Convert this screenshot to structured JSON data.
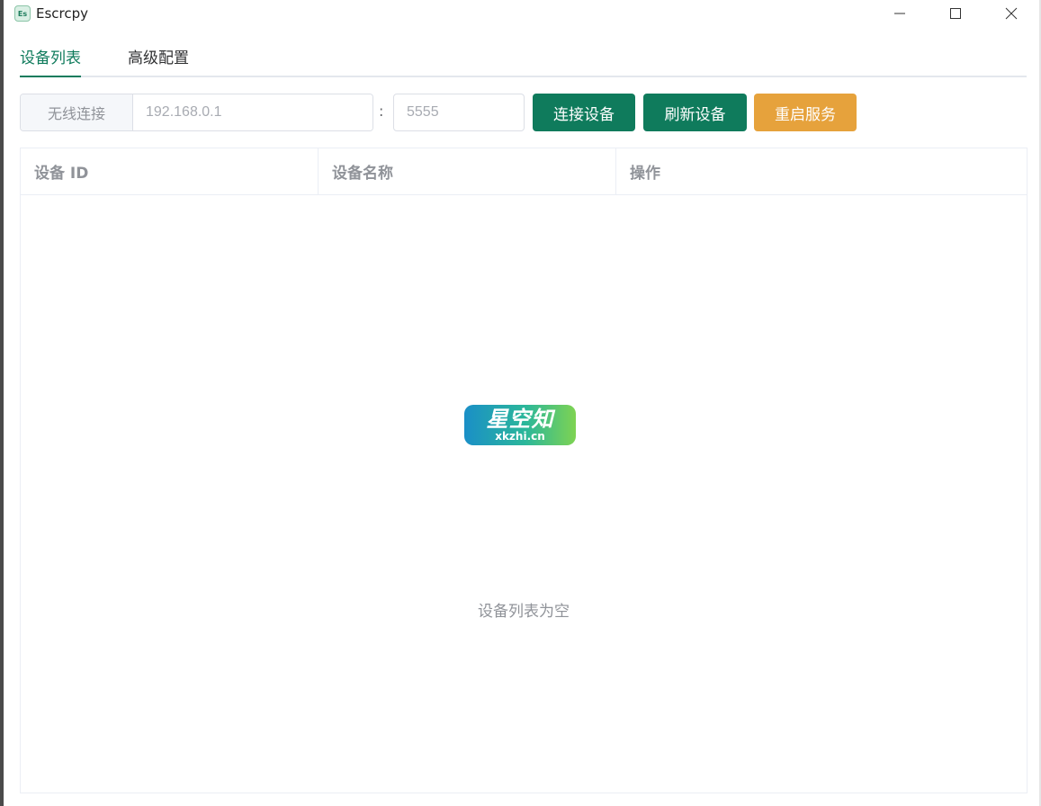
{
  "window": {
    "title": "Escrcpy",
    "icon_text": "Es"
  },
  "tabs": [
    {
      "label": "设备列表",
      "active": true
    },
    {
      "label": "高级配置",
      "active": false
    }
  ],
  "toolbar": {
    "wireless_label": "无线连接",
    "ip_placeholder": "192.168.0.1",
    "separator": ":",
    "port_placeholder": "5555",
    "connect_label": "连接设备",
    "refresh_label": "刷新设备",
    "restart_label": "重启服务"
  },
  "table": {
    "columns": [
      "设备 ID",
      "设备名称",
      "操作"
    ],
    "rows": [],
    "empty_text": "设备列表为空"
  },
  "watermark": {
    "main": "星空知",
    "sub": "xkzhi.cn"
  },
  "colors": {
    "primary": "#0f7b5c",
    "warning": "#e6a23c",
    "border": "#dcdfe6"
  }
}
